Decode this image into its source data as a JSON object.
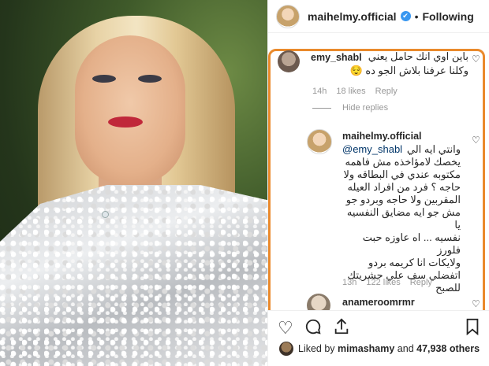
{
  "header": {
    "username": "maihelmy.official",
    "verified_mark": "✔",
    "separator": "•",
    "follow_status": "Following"
  },
  "comments": [
    {
      "username": "emy_shabl",
      "text_line1": "باين اوي انك حامل يعني",
      "text_line2": "وكلنا عرفنا بلاش الجو ده 😌",
      "time": "14h",
      "likes": "18 likes",
      "reply_label": "Reply",
      "hide_replies": "Hide replies"
    }
  ],
  "reply": {
    "username": "maihelmy.official",
    "mention": "@emy_shabl",
    "lines": [
      "وانتي ايه الي",
      "يخصك لامؤاخذه مش فاهمه",
      "مكتوبه عندي في البطاقه ولا",
      "حاجه ؟ فرد من افراد العيله",
      "المقربين ولا حاجه وبردو جو",
      "مش جو ايه مضايق النفسيه يا",
      "نفسيه ... اه عاوزه حبت فلورز",
      "ولايكات انا كريمه بردو",
      "اتفضلي سف علي حشريتك",
      "للصبح"
    ],
    "time": "13h",
    "likes": "122 likes",
    "reply_label": "Reply"
  },
  "next_comment": {
    "username": "anameroomrmr"
  },
  "likes_bar": {
    "prefix": "Liked by",
    "user": "mimashamy",
    "middle": "and",
    "count": "47,938 others"
  },
  "icons": [
    "heart-icon",
    "comment-icon",
    "share-icon",
    "bookmark-icon",
    "verified-icon"
  ],
  "colors": {
    "highlight": "#ea8a2c",
    "verified": "#3897f0",
    "mention": "#003569"
  }
}
